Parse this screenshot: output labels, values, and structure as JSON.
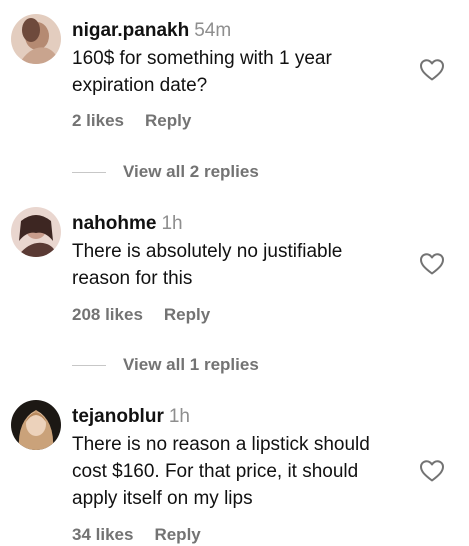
{
  "comments": [
    {
      "username": "nigar.panakh",
      "time": "54m",
      "text_lines": [
        "160$ for something with 1 year",
        "expiration date?"
      ],
      "likes": "2 likes",
      "reply": "Reply",
      "view_replies": "View all 2 replies",
      "avatar_colors": [
        "#c9a48e",
        "#7a5648"
      ]
    },
    {
      "username": "nahohme",
      "time": "1h",
      "text_lines": [
        "There is absolutely no justifiable",
        "reason for this"
      ],
      "likes": "208 likes",
      "reply": "Reply",
      "view_replies": "View all 1 replies",
      "avatar_colors": [
        "#d8b8ad",
        "#4a2e2a"
      ]
    },
    {
      "username": "tejanoblur",
      "time": "1h",
      "text_lines": [
        "There is no reason a lipstick should",
        "cost $160. For that price, it should",
        "apply itself on my lips"
      ],
      "likes": "34 likes",
      "reply": "Reply",
      "avatar_colors": [
        "#e6c9a6",
        "#1c1814"
      ]
    }
  ],
  "icons": {
    "like": "heart-outline-icon"
  }
}
